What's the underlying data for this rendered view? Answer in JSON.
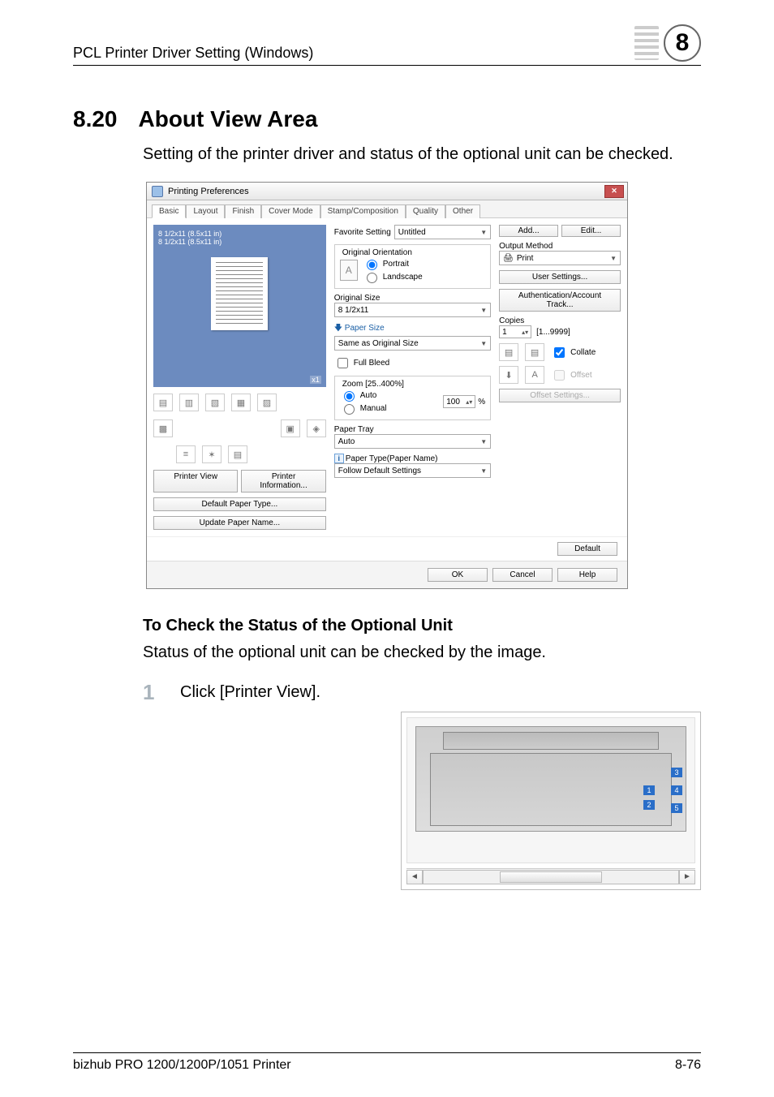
{
  "header": {
    "breadcrumb": "PCL Printer Driver Setting (Windows)",
    "chapter": "8"
  },
  "section": {
    "number": "8.20",
    "title": "About View Area",
    "intro": "Setting of the printer driver and status of the optional unit can be checked."
  },
  "dialog": {
    "title": "Printing Preferences",
    "tabs": [
      "Basic",
      "Layout",
      "Finish",
      "Cover Mode",
      "Stamp/Composition",
      "Quality",
      "Other"
    ],
    "active_tab": 0,
    "preview": {
      "line1": "8 1/2x11 (8.5x11 in)",
      "line2": "8 1/2x11 (8.5x11 in)",
      "count": "x1"
    },
    "left_buttons": {
      "printer_view": "Printer View",
      "printer_info": "Printer Information...",
      "default_paper": "Default Paper Type...",
      "update_paper": "Update Paper Name..."
    },
    "favorite": {
      "label": "Favorite Setting",
      "value": "Untitled",
      "add": "Add...",
      "edit": "Edit..."
    },
    "orientation": {
      "legend": "Original Orientation",
      "portrait": "Portrait",
      "landscape": "Landscape",
      "selected": "portrait"
    },
    "original_size": {
      "label": "Original Size",
      "value": "8 1/2x11"
    },
    "paper_size": {
      "label": "Paper Size",
      "value": "Same as Original Size"
    },
    "full_bleed": {
      "label": "Full Bleed",
      "checked": false
    },
    "zoom": {
      "legend": "Zoom [25..400%]",
      "auto": "Auto",
      "manual": "Manual",
      "selected": "auto",
      "value": "100",
      "suffix": "%"
    },
    "paper_tray": {
      "label": "Paper Tray",
      "value": "Auto"
    },
    "paper_type": {
      "info_label": "Paper Type(Paper Name)",
      "value": "Follow Default Settings"
    },
    "output_method": {
      "label": "Output Method",
      "value": "Print"
    },
    "user_settings": "User Settings...",
    "auth": "Authentication/Account Track...",
    "copies": {
      "label": "Copies",
      "value": "1",
      "range": "[1...9999]"
    },
    "collate": {
      "label": "Collate",
      "checked": true
    },
    "offset": {
      "label": "Offset",
      "checked": false,
      "btn": "Offset Settings..."
    },
    "default_btn": "Default",
    "ok_btn": "OK",
    "cancel_btn": "Cancel",
    "help_btn": "Help"
  },
  "sub": {
    "heading": "To Check the Status of the Optional Unit",
    "text": "Status of the optional unit can be checked by the image.",
    "step_num": "1",
    "step_text": "Click [Printer View]."
  },
  "printer_view": {
    "tags": [
      "1",
      "2",
      "3",
      "4",
      "5"
    ]
  },
  "footer": {
    "left": "bizhub PRO 1200/1200P/1051 Printer",
    "right": "8-76"
  }
}
